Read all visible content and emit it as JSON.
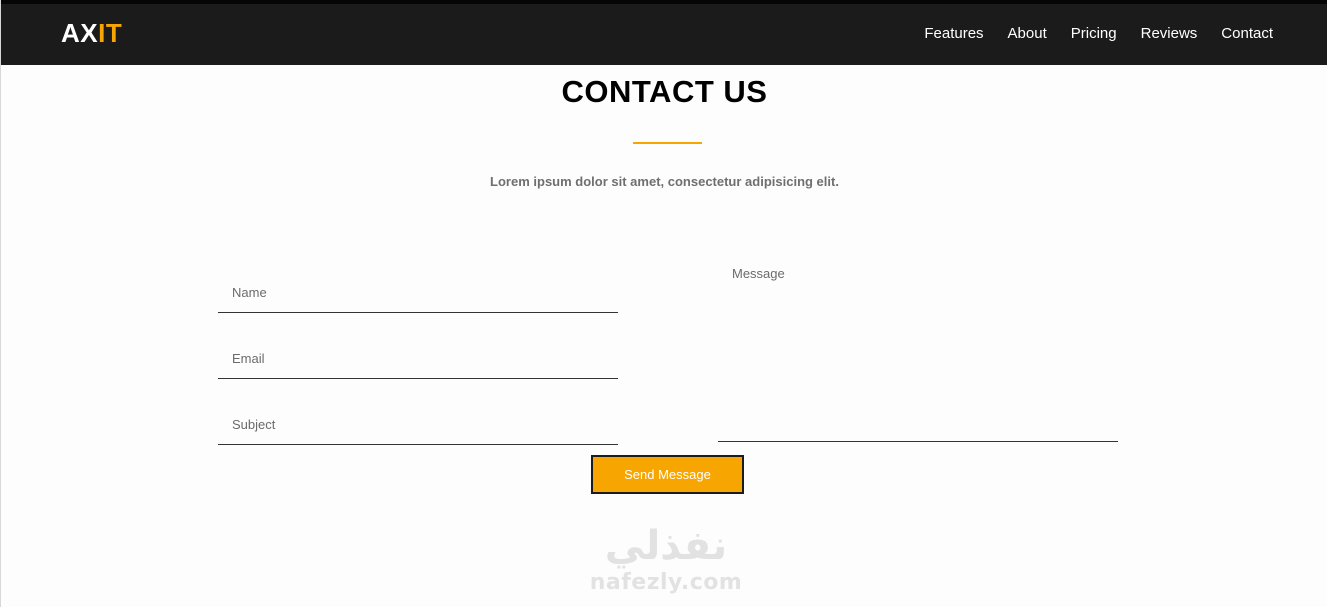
{
  "header": {
    "logo_part1": "AX",
    "logo_part2": "IT",
    "nav": [
      "Features",
      "About",
      "Pricing",
      "Reviews",
      "Contact"
    ]
  },
  "contact": {
    "title": "CONTACT US",
    "subtitle": "Lorem ipsum dolor sit amet, consectetur adipisicing elit.",
    "name_placeholder": "Name",
    "email_placeholder": "Email",
    "subject_placeholder": "Subject",
    "message_placeholder": "Message",
    "send_label": "Send Message"
  },
  "watermark": {
    "arabic": "نفذلي",
    "latin": "nafezly.com"
  },
  "colors": {
    "accent": "#f7a500",
    "header_bg": "#1b1b1b"
  }
}
